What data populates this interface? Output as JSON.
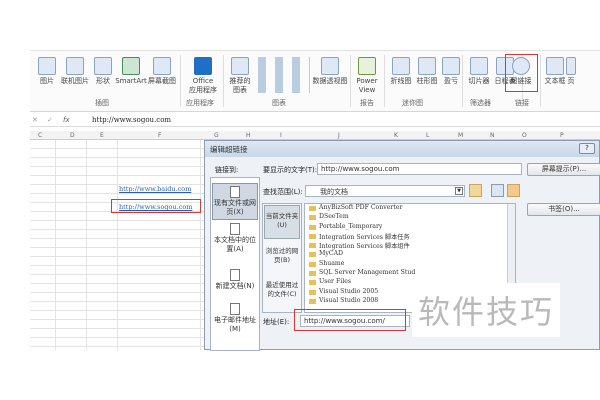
{
  "ribbon": {
    "items": [
      "图片",
      "联机图片",
      "形状",
      "SmartArt",
      "屏幕截图",
      "Office\n应用程序",
      "推荐的\n图表",
      "数据透视图",
      "Power\nView",
      "折线图",
      "柱形图",
      "盈亏",
      "切片器",
      "日程表",
      "超链接",
      "文本框",
      "页"
    ],
    "groups": [
      "插图",
      "应用程序",
      "图表",
      "报告",
      "迷你图",
      "筛选器",
      "链接"
    ]
  },
  "formula_bar": {
    "cancel": "✕",
    "enter": "✓",
    "fx": "fx",
    "value": "http://www.sogou.com"
  },
  "columns": [
    "C",
    "D",
    "E",
    "F",
    "G",
    "H",
    "I",
    "J",
    "K",
    "L",
    "M",
    "N",
    "O",
    "P"
  ],
  "cells": {
    "link1": "http://www.baidu.com",
    "link2": "http://www.sogou.com"
  },
  "dialog": {
    "title": "编辑超链接",
    "help": "?",
    "link_to": "链接到:",
    "display_text_label": "要显示的文字(T):",
    "display_text": "http://www.sogou.com",
    "screentip": "屏幕提示(P)...",
    "lookin_label": "查找范围(L):",
    "lookin": "我的文档",
    "bookmark": "书签(O)...",
    "nav": [
      "现有文件或网页(X)",
      "本文档中的位置(A)",
      "新建文档(N)",
      "电子邮件地址(M)"
    ],
    "subnav": [
      "当前文件夹(U)",
      "浏览过的网页(B)",
      "最近使用过的文件(C)"
    ],
    "files": [
      "AnyBizSoft PDF Converter",
      "DSeeTem",
      "Portable_Temporary",
      "Integration Services 脚本任务",
      "Integration Services 脚本组件",
      "MyCAD",
      "Shuame",
      "SQL Server Management Stud",
      "User Files",
      "Visual Studio 2005",
      "Visual Studio 2008"
    ],
    "address_label": "地址(E):",
    "address": "http://www.sogou.com/"
  },
  "watermark": "软件技巧"
}
